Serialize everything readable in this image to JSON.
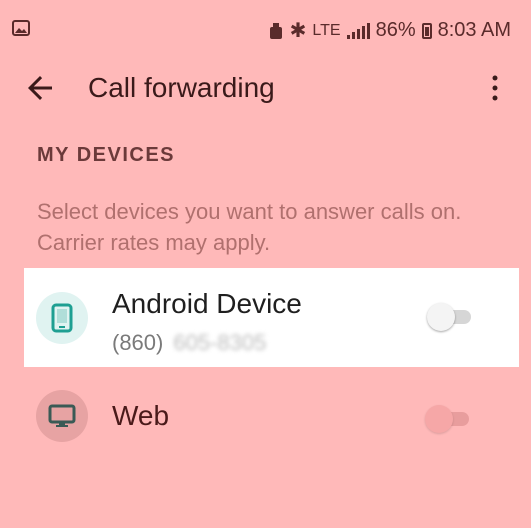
{
  "status_bar": {
    "network": "LTE",
    "battery_percent": "86%",
    "time": "8:03 AM",
    "icons": [
      "image-icon",
      "alarm-icon",
      "bluetooth-icon",
      "lte-icon",
      "signal-icon",
      "battery-icon"
    ]
  },
  "app_bar": {
    "title": "Call forwarding",
    "back_icon": "arrow-left-icon",
    "more_icon": "more-vert-icon"
  },
  "section": {
    "title": "MY DEVICES",
    "description": "Select devices you want to answer calls on. Carrier rates may apply."
  },
  "devices": [
    {
      "label": "Android Device",
      "phone_prefix": "(860)",
      "phone_rest": "605-8305",
      "icon": "phone-icon",
      "enabled": false
    },
    {
      "label": "Web",
      "icon": "monitor-icon",
      "enabled": false
    }
  ],
  "colors": {
    "background": "#ffb9b9",
    "active_row": "#ffffff",
    "accent_teal": "#1e9f92",
    "title_text": "#3a1a1a"
  }
}
